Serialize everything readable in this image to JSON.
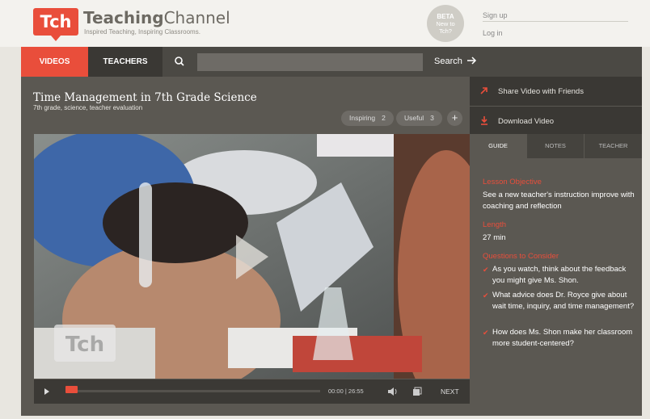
{
  "header": {
    "logo": "Tch",
    "brand_bold": "Teaching",
    "brand_light": "Channel",
    "tagline": "Inspired Teaching, Inspiring Classrooms.",
    "beta_title": "BETA",
    "beta_sub": "New to Tch?",
    "signup": "Sign up",
    "login": "Log in"
  },
  "nav": {
    "videos": "VIDEOS",
    "teachers": "TEACHERS",
    "search_label": "Search"
  },
  "video": {
    "title": "Time Management in 7th Grade Science",
    "tags": "7th grade, science, teacher evaluation",
    "pills": [
      {
        "label": "Inspiring",
        "count": "2"
      },
      {
        "label": "Useful",
        "count": "3"
      }
    ],
    "plus": "+",
    "watermark": "Tch",
    "time_current": "00:00",
    "time_total": "26:55",
    "next": "NEXT"
  },
  "sidebar": {
    "share": "Share Video with Friends",
    "download": "Download Video",
    "tabs": [
      "GUIDE",
      "NOTES",
      "TEACHER"
    ],
    "objective_head": "Lesson Objective",
    "objective_text": "See a new teacher's instruction improve with coaching and reflection",
    "length_head": "Length",
    "length_text": "27 min",
    "questions_head": "Questions to Consider",
    "questions": [
      "As you watch, think about the feedback you might give Ms. Shon.",
      "What advice does Dr. Royce give about wait time, inquiry, and time management?",
      "How does Ms. Shon make her classroom more student-centered?"
    ]
  },
  "colors": {
    "accent": "#e94e3b",
    "nav_bg": "#4b4944",
    "panel_bg": "#5b5852",
    "dark_bg": "#3a3834"
  }
}
